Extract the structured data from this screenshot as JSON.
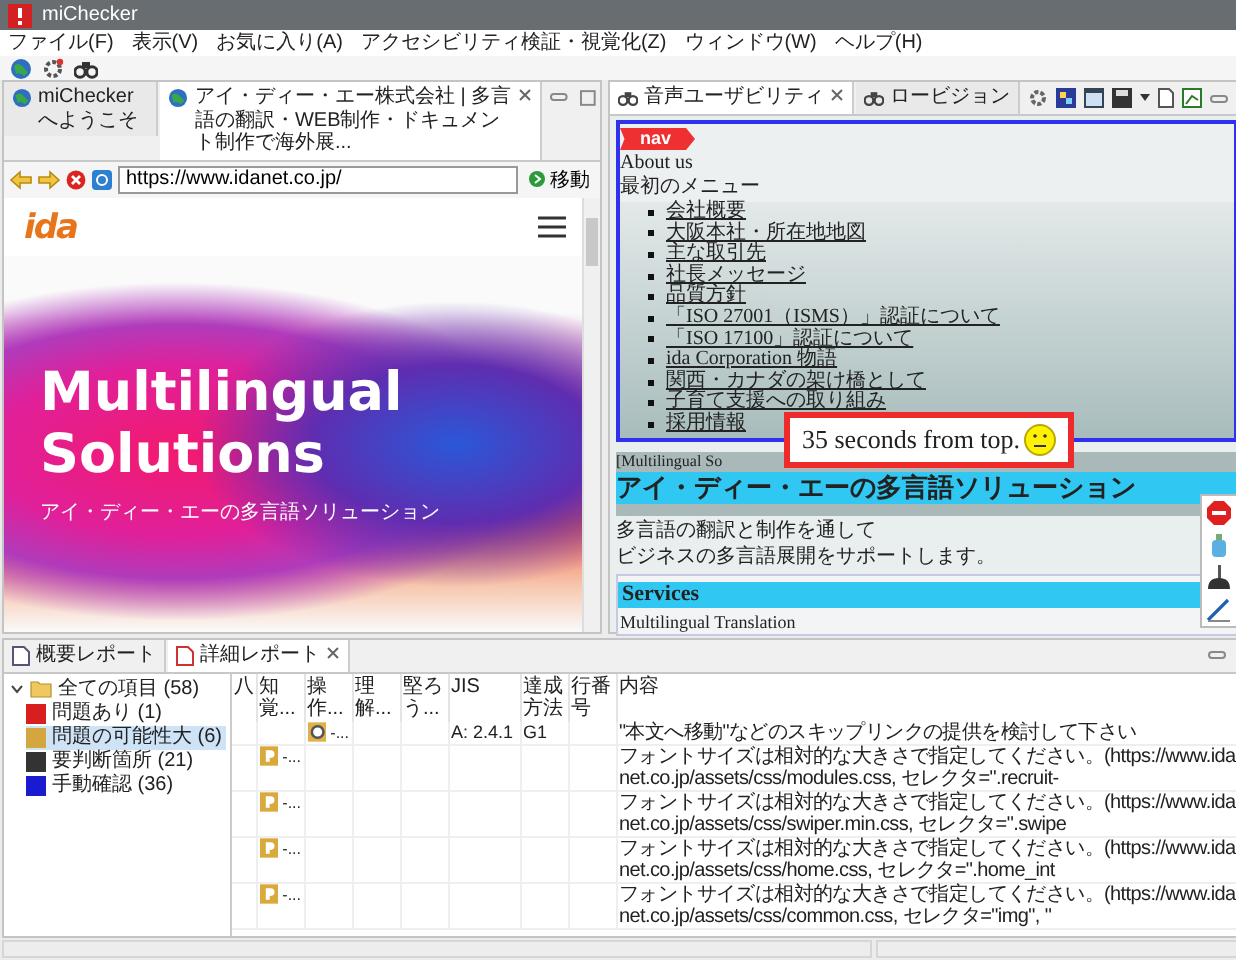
{
  "window": {
    "title": "miChecker"
  },
  "menu": [
    "ファイル(F)",
    "表示(V)",
    "お気に入り(A)",
    "アクセシビリティ検証・視覚化(Z)",
    "ウィンドウ(W)",
    "ヘルプ(H)"
  ],
  "browser": {
    "tabs": [
      {
        "label": "miCheckerへようこそ",
        "selected": false
      },
      {
        "label": "アイ・ディー・エー株式会社 | 多言語の翻訳・WEB制作・ドキュメント制作で海外展...",
        "selected": true
      }
    ],
    "address": "https://www.idanet.co.jp/",
    "go_button": "移動",
    "logo": "ida",
    "hero_title": "Multilingual Solutions",
    "hero_subtitle": "アイ・ディー・エーの多言語ソリューション"
  },
  "checker": {
    "tabs": [
      {
        "label": "音声ユーザビリティ",
        "selected": true
      },
      {
        "label": "ロービジョン",
        "selected": false
      }
    ],
    "nav_badge": "nav",
    "about_heading": "About us",
    "menu_title": "最初のメニュー",
    "links": [
      "会社概要",
      "大阪本社・所在地地図",
      "主な取引先",
      "社長メッセージ",
      "品質方針",
      "「ISO 27001（ISMS）」認証について",
      "「ISO 17100」認証について",
      "ida Corporation 物語",
      "関西・カナダの架け橋として",
      "子育て支援への取り組み",
      "採用情報"
    ],
    "section_label": "[Multilingual So",
    "main_heading": "アイ・ディー・エーの多言語ソリューション",
    "paragraphs": [
      "多言語の翻訳と制作を通して",
      "ビジネスの多言語展開をサポートします。"
    ],
    "services_heading": "Services",
    "services_item": "Multilingual Translation",
    "popup": "35 seconds from top."
  },
  "report": {
    "tabs": [
      {
        "label": "概要レポート",
        "selected": false
      },
      {
        "label": "詳細レポート",
        "selected": true
      }
    ],
    "tree": {
      "label": "全ての項目 (58)",
      "expanded": true,
      "children": [
        {
          "label": "問題あり (1)",
          "color": "#d81e1e",
          "selected": false
        },
        {
          "label": "問題の可能性大 (6)",
          "color": "#d4a640",
          "selected": true
        },
        {
          "label": "要判断箇所 (21)",
          "color": "#333333",
          "selected": false
        },
        {
          "label": "手動確認 (36)",
          "color": "#1a1ad0",
          "selected": false
        }
      ]
    },
    "columns": [
      "八",
      "知覚...",
      "操作...",
      "理解...",
      "堅ろう...",
      "JIS",
      "達成方法",
      "行番号",
      "内容"
    ],
    "rows": [
      {
        "kind": "operable",
        "marker": "-...",
        "jis": "A: 2.4.1",
        "technique": "G1",
        "content": "\"本文へ移動\"などのスキップリンクの提供を検討して下さい"
      },
      {
        "kind": "perceivable",
        "marker": "-...",
        "content": "フォントサイズは相対的な大きさで指定してください。(https://www.idanet.co.jp/assets/css/modules.css, セレクタ=\".recruit-"
      },
      {
        "kind": "perceivable",
        "marker": "-...",
        "content": "フォントサイズは相対的な大きさで指定してください。(https://www.idanet.co.jp/assets/css/swiper.min.css, セレクタ=\".swipe"
      },
      {
        "kind": "perceivable",
        "marker": "-...",
        "content": "フォントサイズは相対的な大きさで指定してください。(https://www.idanet.co.jp/assets/css/home.css, セレクタ=\".home_int"
      },
      {
        "kind": "perceivable",
        "marker": "-...",
        "content": "フォントサイズは相対的な大きさで指定してください。(https://www.idanet.co.jp/assets/css/common.css, セレクタ=\"img\", \""
      }
    ]
  }
}
